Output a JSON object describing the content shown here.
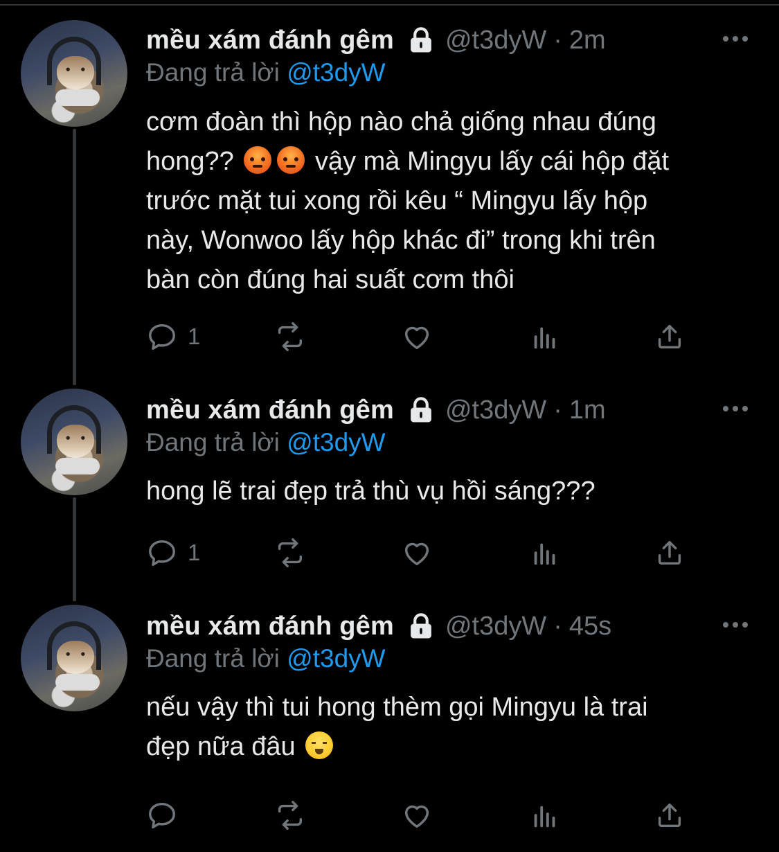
{
  "colors": {
    "background": "#000000",
    "text": "#e7e9ea",
    "secondary": "#71767b",
    "accent": "#1d9bf0",
    "thread_line": "#333639"
  },
  "tweets": [
    {
      "display_name": "mều xám đánh gêm",
      "protected_icon": "lock-icon",
      "handle": "@t3dyW",
      "separator": "·",
      "time": "2m",
      "replying_prefix": "Đang trả lời",
      "replying_to": "@t3dyW",
      "body_parts": [
        "cơm đoàn thì hộp nào chả giống nhau đúng\nhong?? ",
        " vậy mà Mingyu lấy cái hộp đặt\ntrước mặt tui xong rồi kêu “ Mingyu lấy hộp\nnày, Wonwoo lấy hộp khác đi” trong khi trên\nbàn còn đúng hai suất cơm thôi"
      ],
      "emojis": [
        "angry-face-emoji",
        "angry-face-emoji"
      ],
      "reply_count": "1",
      "actions": [
        "reply-icon",
        "retweet-icon",
        "like-icon",
        "views-icon",
        "share-icon"
      ]
    },
    {
      "display_name": "mều xám đánh gêm",
      "protected_icon": "lock-icon",
      "handle": "@t3dyW",
      "separator": "·",
      "time": "1m",
      "replying_prefix": "Đang trả lời",
      "replying_to": "@t3dyW",
      "body": "hong lẽ trai đẹp trả thù vụ hồi sáng???",
      "reply_count": "1",
      "actions": [
        "reply-icon",
        "retweet-icon",
        "like-icon",
        "views-icon",
        "share-icon"
      ]
    },
    {
      "display_name": "mều xám đánh gêm",
      "protected_icon": "lock-icon",
      "handle": "@t3dyW",
      "separator": "·",
      "time": "45s",
      "replying_prefix": "Đang trả lời",
      "replying_to": "@t3dyW",
      "body_parts": [
        "nếu vậy thì tui hong thèm gọi Mingyu là trai\nđẹp nữa đâu "
      ],
      "emojis": [
        "face-with-steam-emoji"
      ],
      "reply_count": "",
      "actions": [
        "reply-icon",
        "retweet-icon",
        "like-icon",
        "views-icon",
        "share-icon"
      ]
    }
  ]
}
